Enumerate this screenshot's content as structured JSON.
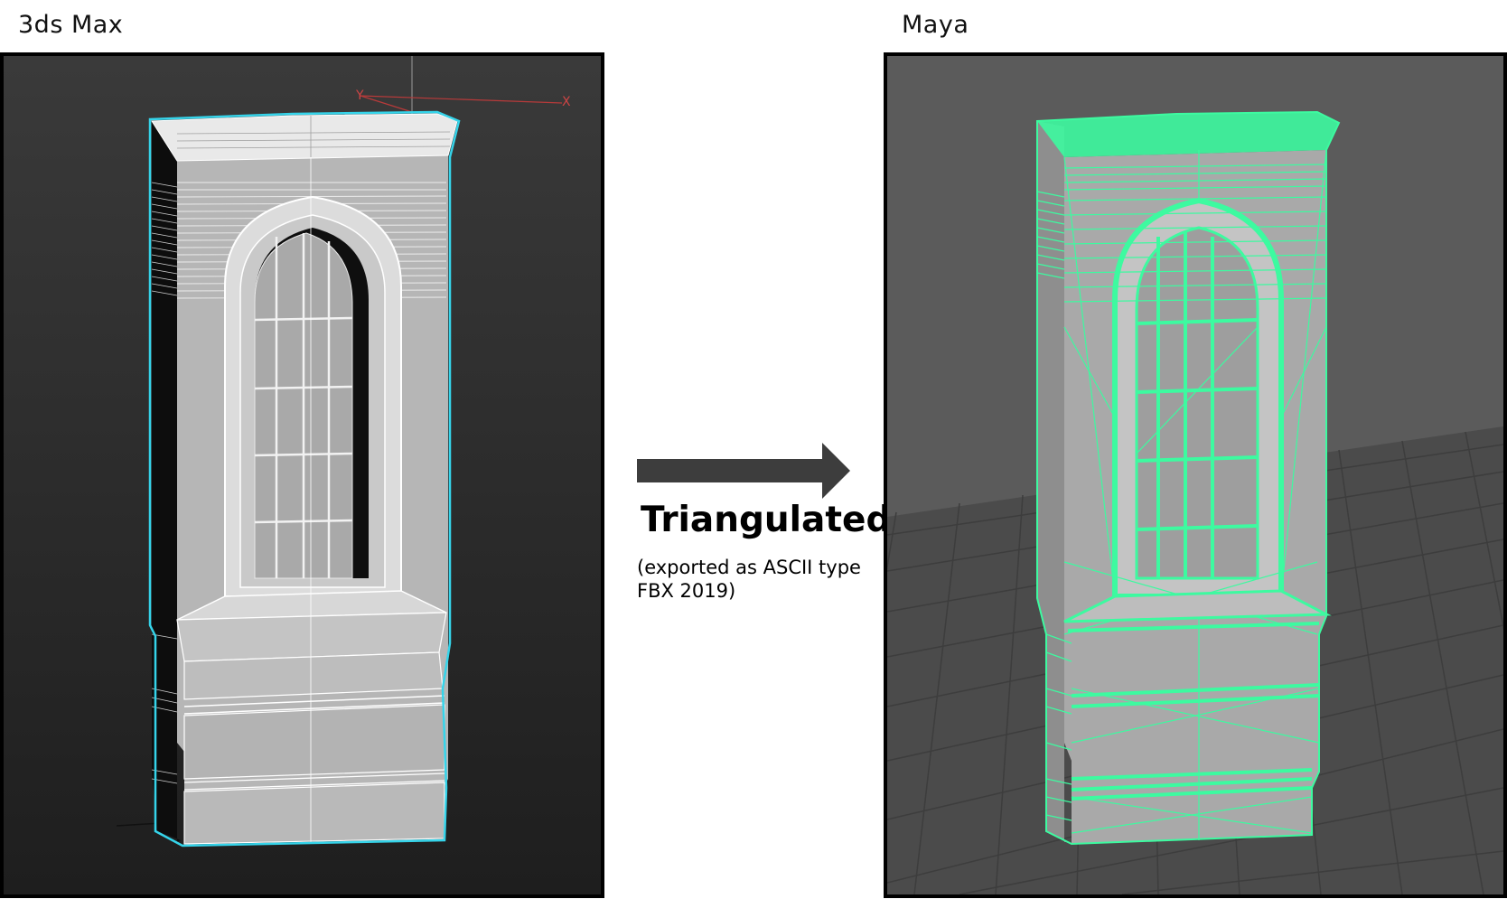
{
  "left_viewport": {
    "label": "3ds Max",
    "axis_y": "Y",
    "axis_x": "X"
  },
  "right_viewport": {
    "label": "Maya"
  },
  "transition": {
    "title": "Triangulated",
    "note_line1": "(exported as ASCII type",
    "note_line2": "FBX 2019)",
    "icon": "arrow-right-icon"
  },
  "colors": {
    "max_bg_top": "#3a3a3a",
    "max_bg_bottom": "#1e1e1e",
    "maya_bg": "#5b5b5b",
    "selection_cyan": "#35d4ea",
    "maya_wire": "#3dfaa0",
    "arrow": "#3d3d3d"
  }
}
